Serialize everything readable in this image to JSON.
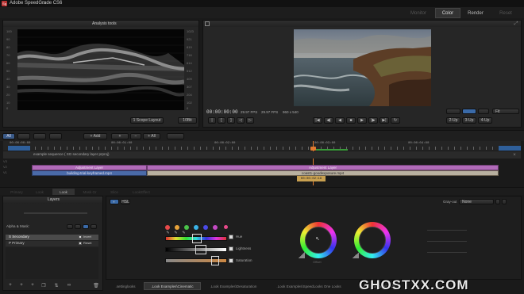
{
  "app": {
    "title": "Adobe SpeedGrade CS6",
    "close": "×"
  },
  "main_tabs": [
    {
      "label": "Monitor",
      "active": false
    },
    {
      "label": "Color",
      "active": true
    },
    {
      "label": "Render",
      "active": false
    },
    {
      "label": "Reset",
      "active": false
    }
  ],
  "analysis": {
    "title": "Analysis tools",
    "scale_labels": [
      "1023",
      "921",
      "819",
      "716",
      "614",
      "512",
      "409",
      "307",
      "204",
      "102",
      "0"
    ],
    "left_labels": [
      "100",
      "90",
      "80",
      "70",
      "60",
      "50",
      "40",
      "30",
      "20",
      "10",
      "0"
    ],
    "layout_select": "1 Scope Layout",
    "bit_select": "10Bit"
  },
  "monitor": {
    "timecode": "00:00:00:00",
    "fps": "29.97 FPS",
    "fps2": "29.97 FPS",
    "resolution": "960 x 540",
    "fit": "Fit",
    "view_1up": "2-Up",
    "view_3up": "3-Up",
    "view_4up": "4-Up"
  },
  "timeline": {
    "all_label": "All",
    "add_label": "+ Add",
    "plus_all": "+ All",
    "ruler_marks": [
      "00:00:00:00",
      "00:00:01:00",
      "00:00:02:00",
      "00:00:03:00",
      "00:00:04:00"
    ],
    "sequence_name": "example sequence ( SG secondary layer prproj)",
    "tracks": [
      "V3",
      "V2",
      "V1"
    ],
    "clip_adjustment_left": "Adjustment Layer",
    "clip_adjustment_right": "Adjustment Layer",
    "clip_video_left": "building-trial-keyframed.mp4",
    "clip_video_right": "coast1-goodexposure.mp4",
    "clip_timecode": "00:00:02:18"
  },
  "lower_tabs": [
    "Primary",
    "Look",
    "Look",
    "Mask Gr",
    "Slice",
    "Look",
    "Effect"
  ],
  "layers": {
    "title": "Layers",
    "alpha_mask_label": "Alpha & Mask:",
    "rows": [
      {
        "label": "S   Secondary",
        "right": "Invert",
        "selected": true
      },
      {
        "label": "P   Primary",
        "right": "Reset",
        "selected": false
      }
    ]
  },
  "secondary": {
    "hsl_label": "HSL",
    "gray_out_label": "Gray-out",
    "gray_out_value": "None",
    "hue_label": "Hue",
    "lightness_label": "Lightness",
    "saturation_label": "Saturation",
    "wheel_label": "Offset",
    "swatch_colors": [
      "#e84a4a",
      "#e8a33a",
      "#4ac34a",
      "#3ab3e8",
      "#4a4ae8",
      "#c34ac3",
      "#e84a8a"
    ]
  },
  "look_tabs": [
    ".settinglooks",
    ".Look Examples\\Cinematic",
    ".Look Examples\\Desaturation",
    ".Look Examples\\SpeedLooks One Looks",
    ".Look Examples\\Stuff"
  ],
  "watermark": "GHOSTXX.COM"
}
